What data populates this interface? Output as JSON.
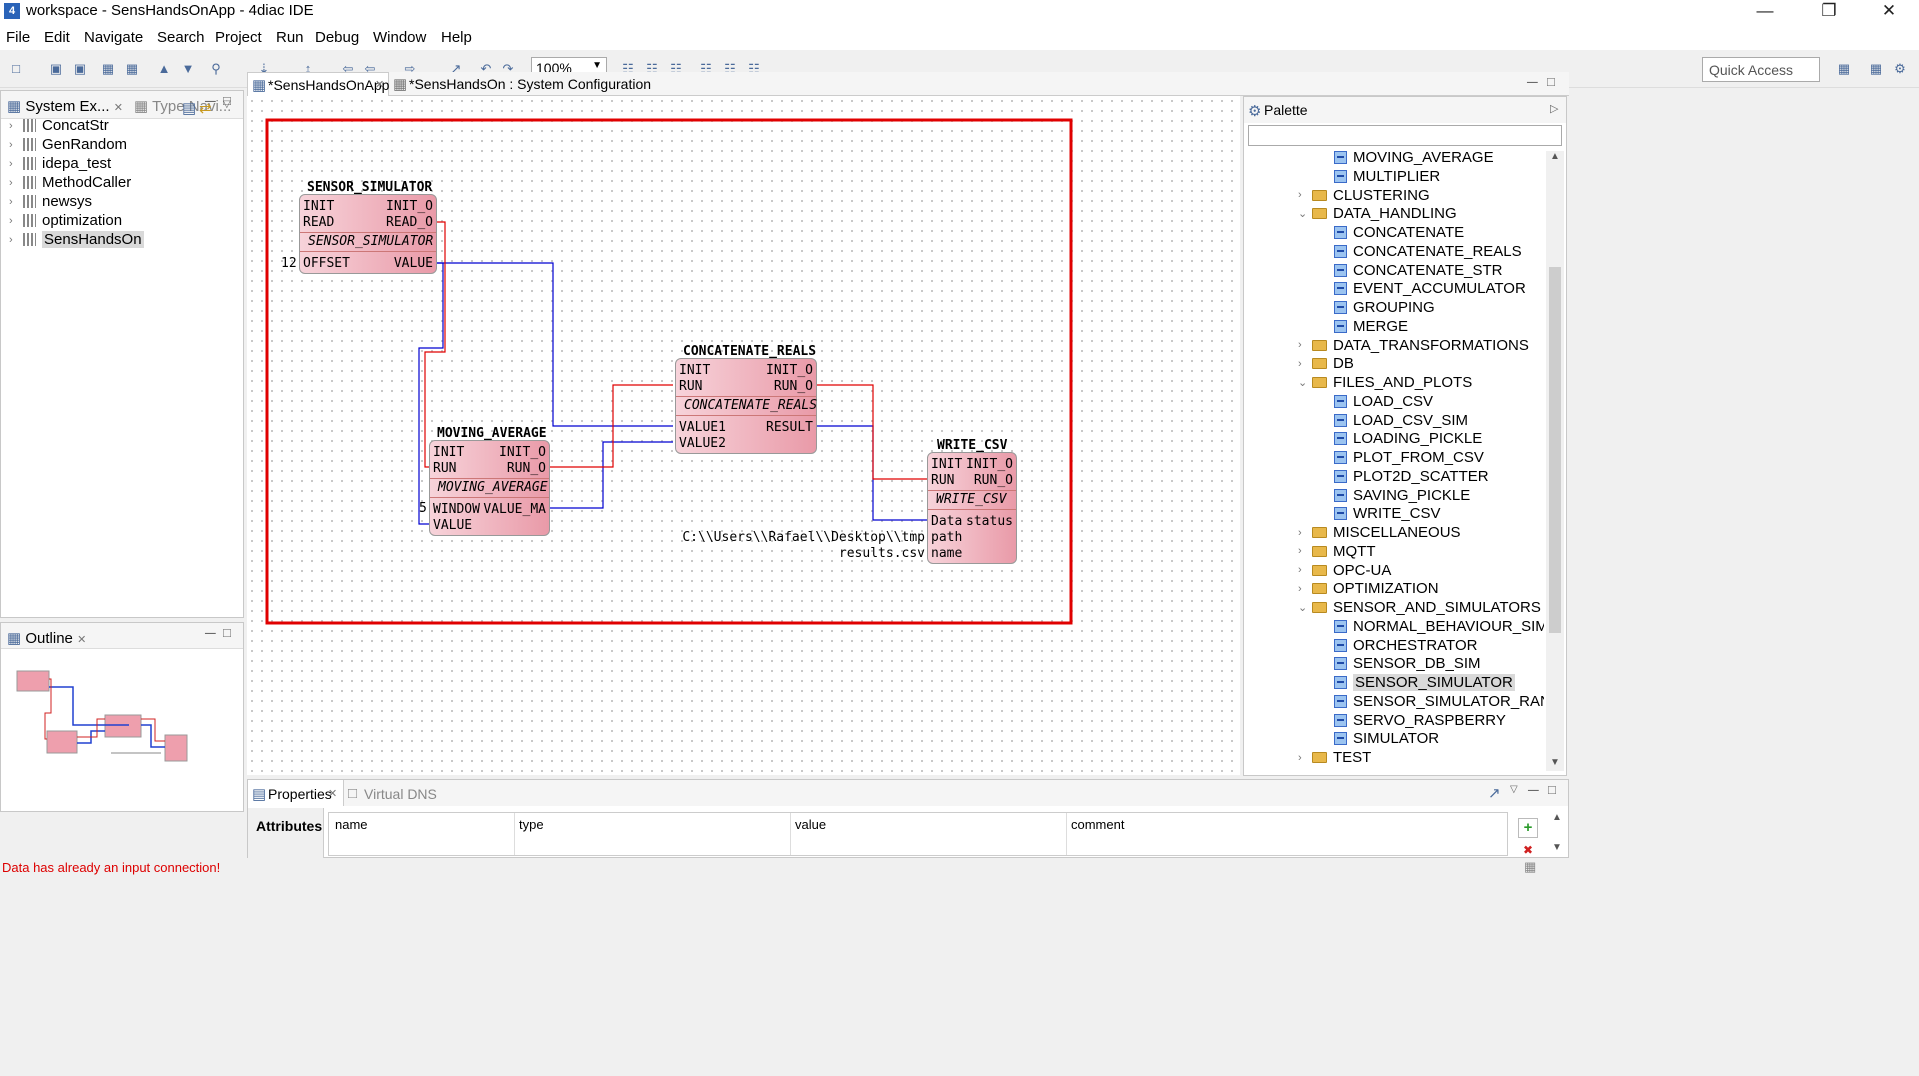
{
  "window": {
    "title": "workspace - SensHandsOnApp - 4diac IDE"
  },
  "menu": [
    "File",
    "Edit",
    "Navigate",
    "Search",
    "Project",
    "Run",
    "Debug",
    "Window",
    "Help"
  ],
  "toolbar": {
    "zoom": "100%",
    "quick_access": "Quick Access"
  },
  "left_panel": {
    "tabs": [
      "System Ex...",
      "Type Navi..."
    ],
    "items": [
      "ConcatStr",
      "GenRandom",
      "idepa_test",
      "MethodCaller",
      "newsys",
      "optimization",
      "SensHandsOn"
    ],
    "selected": "SensHandsOn"
  },
  "outline": {
    "title": "Outline"
  },
  "editor": {
    "tabs": [
      "*SensHandsOnApp",
      "*SensHandsOn : System Configuration"
    ],
    "blocks": {
      "sensor_sim": {
        "name": "SENSOR_SIMULATOR",
        "type": "SENSOR_SIMULATOR",
        "in_events": [
          "INIT",
          "READ"
        ],
        "out_events": [
          "INIT_O",
          "READ_O"
        ],
        "in_data": [
          "OFFSET"
        ],
        "out_data": [
          "VALUE"
        ]
      },
      "concat": {
        "name": "CONCATENATE_REALS",
        "type": "CONCATENATE_REALS",
        "in_events": [
          "INIT",
          "RUN"
        ],
        "out_events": [
          "INIT_O",
          "RUN_O"
        ],
        "in_data": [
          "VALUE1",
          "VALUE2"
        ],
        "out_data": [
          "RESULT"
        ]
      },
      "moving": {
        "name": "MOVING_AVERAGE",
        "type": "MOVING_AVERAGE",
        "in_events": [
          "INIT",
          "RUN"
        ],
        "out_events": [
          "INIT_O",
          "RUN_O"
        ],
        "in_data": [
          "WINDOW",
          "VALUE"
        ],
        "out_data": [
          "VALUE_MA"
        ]
      },
      "write": {
        "name": "WRITE_CSV",
        "type": "WRITE_CSV",
        "in_events": [
          "INIT",
          "RUN"
        ],
        "out_events": [
          "INIT_O",
          "RUN_O"
        ],
        "in_data": [
          "Data",
          "path",
          "name"
        ],
        "out_data": [
          "status"
        ]
      }
    },
    "params": {
      "offset": "12",
      "window": "5",
      "path": "C:\\\\Users\\\\Rafael\\\\Desktop\\\\tmp",
      "name": "results.csv"
    }
  },
  "palette": {
    "title": "Palette",
    "items": [
      {
        "label": "MOVING_AVERAGE",
        "kind": "fb",
        "level": 2
      },
      {
        "label": "MULTIPLIER",
        "kind": "fb",
        "level": 2
      },
      {
        "label": "CLUSTERING",
        "kind": "folder",
        "level": 1,
        "state": "collapsed"
      },
      {
        "label": "DATA_HANDLING",
        "kind": "folder",
        "level": 1,
        "state": "expanded"
      },
      {
        "label": "CONCATENATE",
        "kind": "fb",
        "level": 2
      },
      {
        "label": "CONCATENATE_REALS",
        "kind": "fb",
        "level": 2
      },
      {
        "label": "CONCATENATE_STR",
        "kind": "fb",
        "level": 2
      },
      {
        "label": "EVENT_ACCUMULATOR",
        "kind": "fb",
        "level": 2
      },
      {
        "label": "GROUPING",
        "kind": "fb",
        "level": 2
      },
      {
        "label": "MERGE",
        "kind": "fb",
        "level": 2
      },
      {
        "label": "DATA_TRANSFORMATIONS",
        "kind": "folder",
        "level": 1,
        "state": "collapsed"
      },
      {
        "label": "DB",
        "kind": "folder",
        "level": 1,
        "state": "collapsed"
      },
      {
        "label": "FILES_AND_PLOTS",
        "kind": "folder",
        "level": 1,
        "state": "expanded"
      },
      {
        "label": "LOAD_CSV",
        "kind": "fb",
        "level": 2
      },
      {
        "label": "LOAD_CSV_SIM",
        "kind": "fb",
        "level": 2
      },
      {
        "label": "LOADING_PICKLE",
        "kind": "fb",
        "level": 2
      },
      {
        "label": "PLOT_FROM_CSV",
        "kind": "fb",
        "level": 2
      },
      {
        "label": "PLOT2D_SCATTER",
        "kind": "fb",
        "level": 2
      },
      {
        "label": "SAVING_PICKLE",
        "kind": "fb",
        "level": 2
      },
      {
        "label": "WRITE_CSV",
        "kind": "fb",
        "level": 2
      },
      {
        "label": "MISCELLANEOUS",
        "kind": "folder",
        "level": 1,
        "state": "collapsed"
      },
      {
        "label": "MQTT",
        "kind": "folder",
        "level": 1,
        "state": "collapsed"
      },
      {
        "label": "OPC-UA",
        "kind": "folder",
        "level": 1,
        "state": "collapsed"
      },
      {
        "label": "OPTIMIZATION",
        "kind": "folder",
        "level": 1,
        "state": "collapsed"
      },
      {
        "label": "SENSOR_AND_SIMULATORS",
        "kind": "folder",
        "level": 1,
        "state": "expanded"
      },
      {
        "label": "NORMAL_BEHAVIOUR_SIM",
        "kind": "fb",
        "level": 2
      },
      {
        "label": "ORCHESTRATOR",
        "kind": "fb",
        "level": 2
      },
      {
        "label": "SENSOR_DB_SIM",
        "kind": "fb",
        "level": 2
      },
      {
        "label": "SENSOR_SIMULATOR",
        "kind": "fb",
        "level": 2,
        "selected": true
      },
      {
        "label": "SENSOR_SIMULATOR_RANGE",
        "kind": "fb",
        "level": 2
      },
      {
        "label": "SERVO_RASPBERRY",
        "kind": "fb",
        "level": 2
      },
      {
        "label": "SIMULATOR",
        "kind": "fb",
        "level": 2
      },
      {
        "label": "TEST",
        "kind": "folder",
        "level": 1,
        "state": "collapsed"
      }
    ]
  },
  "properties": {
    "tabs": [
      "Properties",
      "Virtual DNS"
    ],
    "side_tab": "Attributes",
    "columns": [
      "name",
      "type",
      "value",
      "comment"
    ]
  },
  "status": {
    "message": "Data has already an input connection!"
  },
  "colors": {
    "event": "#e00000",
    "data": "#0000d0",
    "selection": "#e00000"
  }
}
